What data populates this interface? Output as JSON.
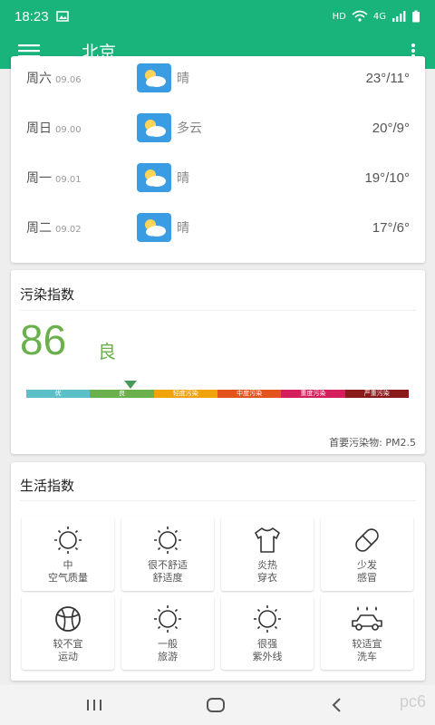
{
  "status_bar": {
    "time": "18:23",
    "indicators": "HD",
    "network": "4G"
  },
  "app_bar": {
    "title": "北京"
  },
  "forecast": [
    {
      "day": "周六",
      "date": "09.06",
      "condition": "晴",
      "temp": "23°/11°"
    },
    {
      "day": "周日",
      "date": "09.00",
      "condition": "多云",
      "temp": "20°/9°"
    },
    {
      "day": "周一",
      "date": "09.01",
      "condition": "晴",
      "temp": "19°/10°"
    },
    {
      "day": "周二",
      "date": "09.02",
      "condition": "晴",
      "temp": "17°/6°"
    }
  ],
  "aqi": {
    "title": "污染指数",
    "value": "86",
    "level": "良",
    "scale": [
      {
        "label": "优",
        "color": "#5bc0c8"
      },
      {
        "label": "良",
        "color": "#6ab04c"
      },
      {
        "label": "轻度污染",
        "color": "#f0a30a"
      },
      {
        "label": "中度污染",
        "color": "#e2531e"
      },
      {
        "label": "重度污染",
        "color": "#d41f5c"
      },
      {
        "label": "严重污染",
        "color": "#8b1a1a"
      }
    ],
    "primary_pollutant": "首要污染物: PM2.5"
  },
  "life": {
    "title": "生活指数",
    "items": [
      {
        "line1": "中",
        "line2": "空气质量",
        "icon": "sun-icon"
      },
      {
        "line1": "很不舒适",
        "line2": "舒适度",
        "icon": "sun-icon"
      },
      {
        "line1": "炎热",
        "line2": "穿衣",
        "icon": "tshirt-icon"
      },
      {
        "line1": "少发",
        "line2": "感冒",
        "icon": "pill-icon"
      },
      {
        "line1": "较不宜",
        "line2": "运动",
        "icon": "basketball-icon"
      },
      {
        "line1": "一般",
        "line2": "旅游",
        "icon": "sun-icon"
      },
      {
        "line1": "很强",
        "line2": "紫外线",
        "icon": "sun-icon"
      },
      {
        "line1": "较适宜",
        "line2": "洗车",
        "icon": "car-wash-icon"
      }
    ]
  },
  "watermark": "pc6"
}
